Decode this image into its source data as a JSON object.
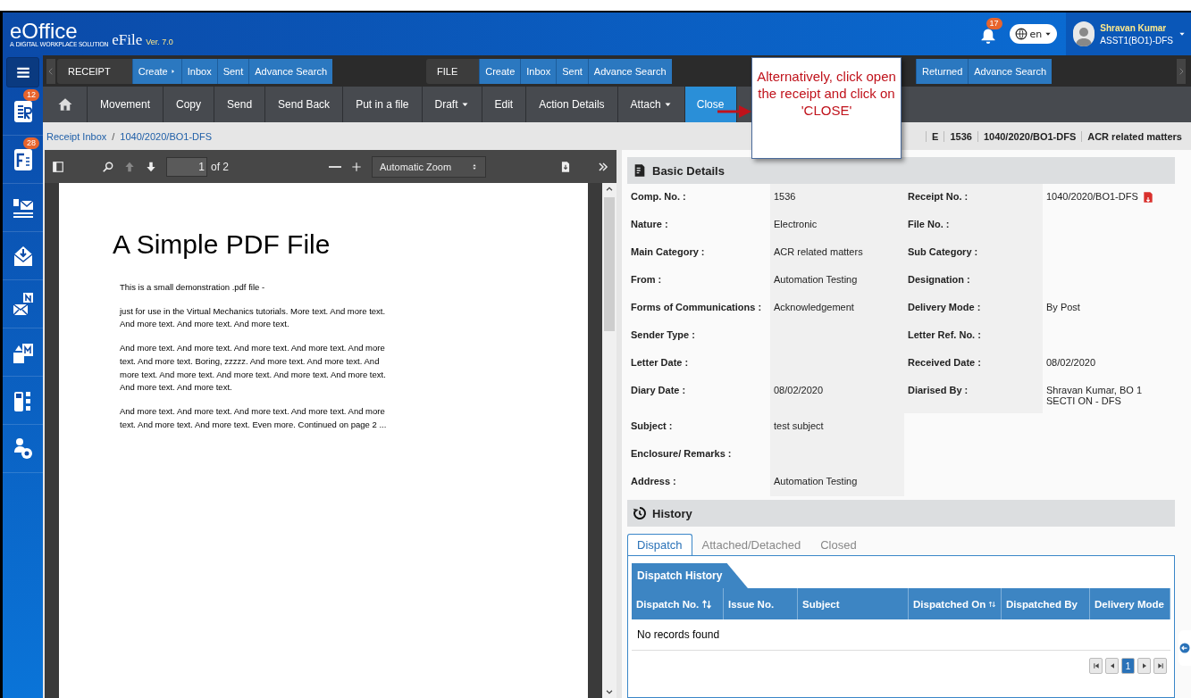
{
  "header": {
    "logo": "eOffice",
    "tagline": "A DIGITAL WORKPLACE SOLUTION",
    "app": "eFile",
    "version": "Ver. 7.0",
    "notifications": "17",
    "language": "en",
    "user": {
      "name": "Shravan Kumar",
      "role": "ASST1(BO1)-DFS"
    }
  },
  "nav_groups": [
    {
      "label": "RECEIPT",
      "items": [
        {
          "label": "Create",
          "submenu": true
        },
        {
          "label": "Inbox",
          "submenu": false
        },
        {
          "label": "Sent",
          "submenu": false
        },
        {
          "label": "Advance Search",
          "submenu": false
        }
      ]
    },
    {
      "label": "FILE",
      "items": [
        {
          "label": "Create",
          "submenu": false
        },
        {
          "label": "Inbox",
          "submenu": false
        },
        {
          "label": "Sent",
          "submenu": false
        },
        {
          "label": "Advance Search",
          "submenu": false
        }
      ]
    },
    {
      "items": [
        {
          "label": "Returned",
          "submenu": false
        },
        {
          "label": "Advance Search",
          "submenu": false
        }
      ]
    }
  ],
  "actions": [
    {
      "label": "Movement",
      "dropdown": false,
      "selected": false
    },
    {
      "label": "Copy",
      "dropdown": false,
      "selected": false
    },
    {
      "label": "Send",
      "dropdown": false,
      "selected": false
    },
    {
      "label": "Send Back",
      "dropdown": false,
      "selected": false
    },
    {
      "label": "Put in a file",
      "dropdown": false,
      "selected": false
    },
    {
      "label": "Draft",
      "dropdown": true,
      "selected": false
    },
    {
      "label": "Edit",
      "dropdown": false,
      "selected": false
    },
    {
      "label": "Action Details",
      "dropdown": false,
      "selected": false
    },
    {
      "label": "Attach",
      "dropdown": true,
      "selected": false
    },
    {
      "label": "Close",
      "dropdown": false,
      "selected": true
    }
  ],
  "callout": "Alternatively, click open the receipt and click on 'CLOSE'",
  "breadcrumb": {
    "items": [
      "Receipt Inbox",
      "1040/2020/BO1-DFS"
    ],
    "separator": "/"
  },
  "summary": [
    "E",
    "1536",
    "1040/2020/BO1-DFS",
    "ACR related matters"
  ],
  "sidebar": [
    {
      "kind": "receipt",
      "badge": "12"
    },
    {
      "kind": "file",
      "badge": "28"
    },
    {
      "kind": "dak"
    },
    {
      "kind": "inbox"
    },
    {
      "kind": "notice"
    },
    {
      "kind": "transfer"
    },
    {
      "kind": "dsc"
    },
    {
      "kind": "settings"
    }
  ],
  "pdf_viewer": {
    "page": "1",
    "page_count": "of 2",
    "zoom": "Automatic Zoom",
    "title": "A Simple PDF File",
    "paragraphs": [
      "This is a small demonstration .pdf file -",
      "just for use in the Virtual Mechanics tutorials. More text. And more text. And more text. And more text. And more text.",
      "And more text. And more text. And more text. And more text. And more text. And more text. Boring, zzzzz. And more text. And more text. And more text. And more text. And more text. And more text. And more text. And more text. And more text.",
      "And more text. And more text. And more text. And more text. And more text. And more text. And more text. Even more. Continued on page 2 ..."
    ]
  },
  "basic_details": {
    "title": "Basic Details",
    "rows": [
      [
        {
          "label": "Comp. No. :",
          "value": "1536"
        },
        {
          "label": "Receipt No. :",
          "value": "1040/2020/BO1-DFS",
          "pdf": true
        }
      ],
      [
        {
          "label": "Nature :",
          "value": "Electronic"
        },
        {
          "label": "File No. :"
        }
      ],
      [
        {
          "label": "Main Category :",
          "value": "ACR related matters"
        },
        {
          "label": "Sub Category :"
        }
      ],
      [
        {
          "label": "From :",
          "value": "Automation Testing"
        },
        {
          "label": "Designation :"
        }
      ],
      [
        {
          "label": "Forms of Communications :",
          "value": "Acknowledgement"
        },
        {
          "label": "Delivery Mode :",
          "value": "By Post"
        }
      ],
      [
        {
          "label": "Sender Type :"
        },
        {
          "label": "Letter Ref. No. :"
        }
      ],
      [
        {
          "label": "Letter Date :"
        },
        {
          "label": "Received Date :",
          "value": "08/02/2020"
        }
      ],
      [
        {
          "label": "Diary Date :",
          "value": "08/02/2020"
        },
        {
          "label": "Diarised By :",
          "value": "Shravan Kumar, BO 1 SECTI ON - DFS"
        }
      ],
      [
        {
          "label": "Subject :",
          "value": "test subject"
        }
      ],
      [
        {
          "label": "Enclosure/ Remarks :"
        }
      ],
      [
        {
          "label": "Address :",
          "value": "Automation Testing"
        }
      ]
    ]
  },
  "history": {
    "title": "History",
    "tabs": [
      {
        "label": "Dispatch",
        "selected": true
      },
      {
        "label": "Attached/Detached",
        "selected": false
      },
      {
        "label": "Closed",
        "selected": false
      }
    ],
    "table_title": "Dispatch History",
    "columns": [
      {
        "label": "Dispatch No.",
        "sortable": true
      },
      {
        "label": "Issue No.",
        "sortable": false
      },
      {
        "label": "Subject",
        "sortable": false
      },
      {
        "label": "Dispatched On",
        "sortable": true
      },
      {
        "label": "Dispatched By",
        "sortable": false
      },
      {
        "label": "Delivery Mode",
        "sortable": false
      }
    ],
    "empty": "No records found",
    "pages": [
      {
        "label": "1",
        "selected": true
      }
    ]
  }
}
